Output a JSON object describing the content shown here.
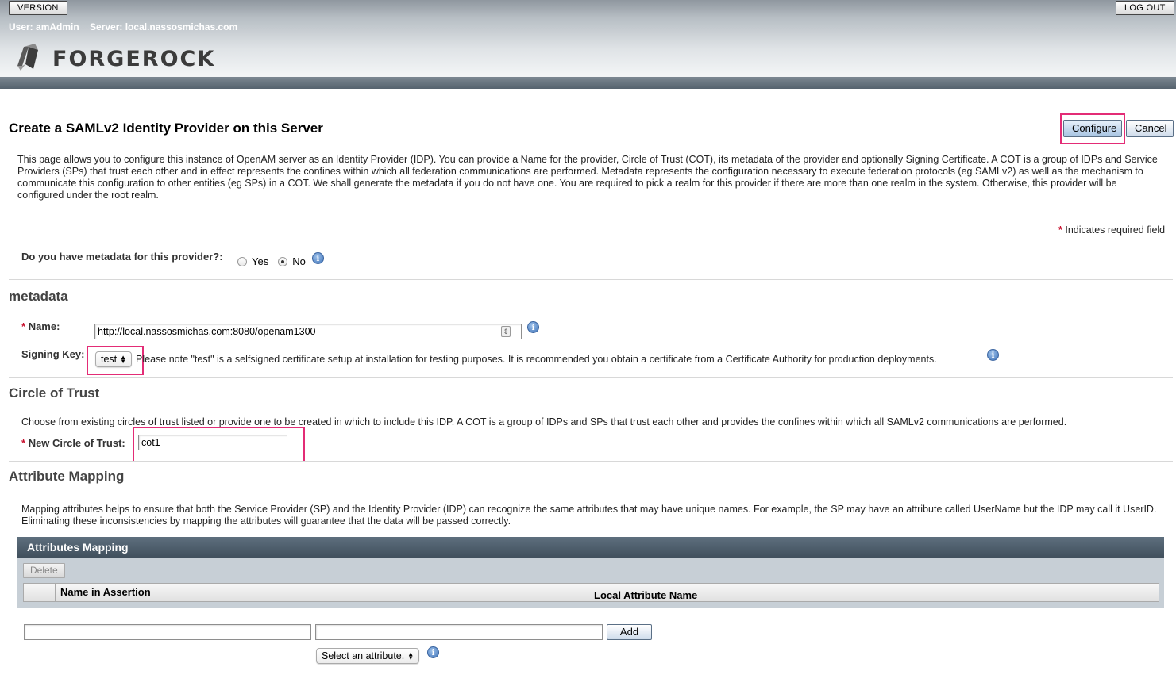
{
  "header": {
    "version_button": "VERSION",
    "logout_button": "LOG OUT",
    "user_label": "User: amAdmin",
    "server_label": "Server: local.nassosmichas.com",
    "logo_text": "FORGEROCK"
  },
  "page": {
    "title": "Create a SAMLv2 Identity Provider on this Server",
    "configure_button": "Configure",
    "cancel_button": "Cancel",
    "intro": "This page allows you to configure this instance of OpenAM server as an Identity Provider (IDP). You can provide a Name for the provider, Circle of Trust (COT), its metadata of the provider and optionally Signing Certificate. A COT is a group of IDPs and Service Providers (SPs) that trust each other and in effect represents the confines within which all federation communications are performed. Metadata represents the configuration necessary to execute federation protocols (eg SAMLv2) as well as the mechanism to communicate this configuration to other entities (eg SPs) in a COT. We shall generate the metadata if you do not have one. You are required to pick a realm for this provider if there are more than one realm in the system. Otherwise, this provider will be configured under the root realm.",
    "required_marker": "*",
    "required_note": "Indicates required field"
  },
  "metadata_question": {
    "label": "Do you have metadata for this provider?:",
    "options": [
      "Yes",
      "No"
    ],
    "selected": "No"
  },
  "metadata": {
    "section_title": "metadata",
    "name_label": "Name:",
    "name_value": "http://local.nassosmichas.com:8080/openam1300",
    "signing_key_label": "Signing Key:",
    "signing_key_value": "test",
    "signing_note": "Please note \"test\" is a selfsigned certificate setup at installation for testing purposes. It is recommended you obtain a certificate from a Certificate Authority for production deployments."
  },
  "cot": {
    "section_title": "Circle of Trust",
    "description": "Choose from existing circles of trust listed or provide one to be created in which to include this IDP. A COT is a group of IDPs and SPs that trust each other and provides the confines within which all SAMLv2 communications are performed.",
    "new_label": "New Circle of Trust:",
    "new_value": "cot1"
  },
  "attribute_mapping": {
    "section_title": "Attribute Mapping",
    "description": "Mapping attributes helps to ensure that both the Service Provider (SP) and the Identity Provider (IDP) can recognize the same attributes that may have unique names. For example, the SP may have an attribute called UserName but the IDP may call it UserID. Eliminating these inconsistencies by mapping the attributes will guarantee that the data will be passed correctly.",
    "table_title": "Attributes Mapping",
    "delete_button": "Delete",
    "columns": [
      "Name in Assertion",
      "Local Attribute Name"
    ],
    "input_assertion_value": "",
    "input_local_value": "",
    "add_button": "Add",
    "select_placeholder": "Select an attribute."
  },
  "icons": {
    "info": "info-icon",
    "logo": "forgerock-logo-icon"
  },
  "colors": {
    "highlight": "#e32c76",
    "required": "#c8102e",
    "table_header": "#4f5f6d"
  }
}
